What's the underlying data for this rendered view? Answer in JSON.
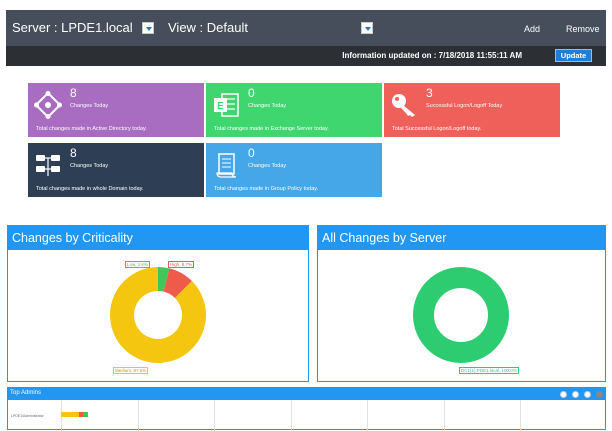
{
  "header": {
    "server_label": "Server : LPDE1.local",
    "view_label": "View : Default",
    "add_label": "Add",
    "remove_label": "Remove"
  },
  "infobar": {
    "updated_text": "Information updated on : 7/18/2018 11:55:11 AM",
    "update_label": "Update"
  },
  "tiles": [
    {
      "count": "8",
      "label": "Changes Today",
      "desc": "Total changes made in Active Directory today.",
      "color": "#a86cc1",
      "icon": "active-directory-icon"
    },
    {
      "count": "0",
      "label": "Changes Today",
      "desc": "Total changes made in Exchange Server today.",
      "color": "#3fd670",
      "icon": "exchange-icon"
    },
    {
      "count": "3",
      "label": "Successful Logon/Logoff Today",
      "desc": "Total Successful Logon/Logoff today.",
      "color": "#f0605a",
      "icon": "key-icon"
    },
    {
      "count": "8",
      "label": "Changes Today",
      "desc": "Total changes made in whole Domain today.",
      "color": "#2e3f55",
      "icon": "domain-icon"
    },
    {
      "count": "0",
      "label": "Changes Today",
      "desc": "Total changes made in Group Policy today.",
      "color": "#45a6e8",
      "icon": "group-policy-icon"
    }
  ],
  "criticality": {
    "title": "Changes by Criticality",
    "chart_data": {
      "type": "pie",
      "labels": [
        "Low",
        "High",
        "Medium"
      ],
      "values": [
        3.8,
        8.7,
        87.5
      ],
      "colors": [
        "#3fc75b",
        "#ef5b4b",
        "#f4c60f"
      ],
      "label_texts": [
        "Low, 3.8%",
        "High, 8.7%",
        "Medium, 87.5%"
      ]
    }
  },
  "by_server": {
    "title": "All Changes by Server",
    "chart_data": {
      "type": "pie",
      "labels": [
        "DC1(1).PDE1.local"
      ],
      "values": [
        100
      ],
      "colors": [
        "#2ecc71"
      ],
      "label_texts": [
        "DC1(1).PDE1.local, 100.0%"
      ]
    }
  },
  "admins": {
    "title": "Top Admins",
    "row_label": "LPDE1\\Administrator"
  }
}
